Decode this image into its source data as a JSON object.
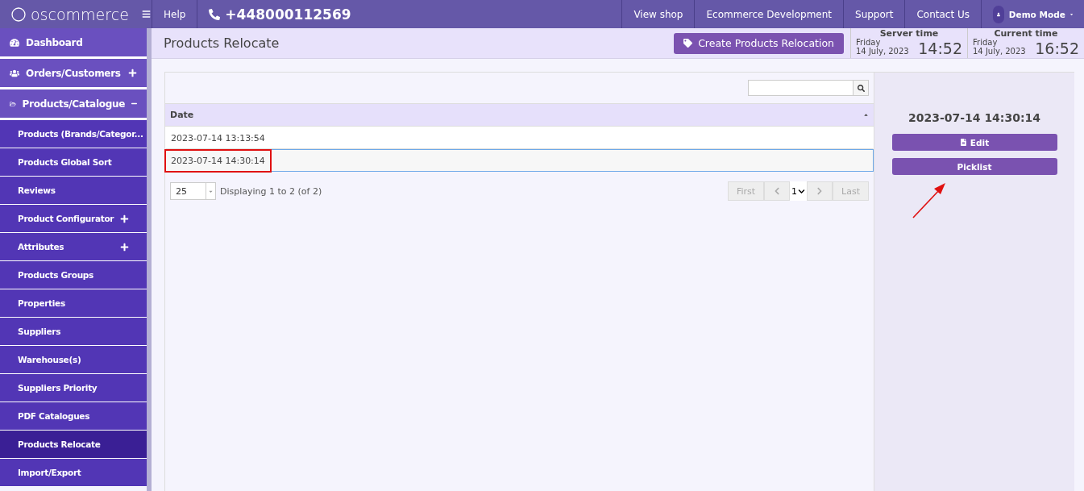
{
  "topbar": {
    "logo": "oscommerce",
    "help": "Help",
    "phone": "+448000112569",
    "links": [
      "View shop",
      "Ecommerce Development",
      "Support",
      "Contact Us"
    ],
    "user": "Demo Mode"
  },
  "sidebar": {
    "items": [
      {
        "label": "Dashboard",
        "selected": false
      },
      {
        "label": "Orders/Customers",
        "selected": false,
        "expanded": false
      },
      {
        "label": "Products/Catalogue",
        "selected": false,
        "expanded": true,
        "children": [
          {
            "label": "Products (Brands/Categor...",
            "selected": false
          },
          {
            "label": "Products Global Sort",
            "selected": false
          },
          {
            "label": "Reviews",
            "selected": false
          },
          {
            "label": "Product Configurator",
            "selected": false,
            "expanded": false
          },
          {
            "label": "Attributes",
            "selected": false,
            "expanded": false
          },
          {
            "label": "Products Groups",
            "selected": false
          },
          {
            "label": "Properties",
            "selected": false
          },
          {
            "label": "Suppliers",
            "selected": false
          },
          {
            "label": "Warehouse(s)",
            "selected": false
          },
          {
            "label": "Suppliers Priority",
            "selected": false
          },
          {
            "label": "PDF Catalogues",
            "selected": false
          },
          {
            "label": "Products Relocate",
            "selected": true
          },
          {
            "label": "Import/Export",
            "selected": false
          }
        ]
      }
    ]
  },
  "header": {
    "title": "Products Relocate",
    "create_button": "Create Products Relocation",
    "clocks": [
      {
        "label": "Server time",
        "day": "Friday",
        "date": "14 July, 2023",
        "time": "14:52"
      },
      {
        "label": "Current time",
        "day": "Friday",
        "date": "14 July, 2023",
        "time": "16:52"
      }
    ]
  },
  "table": {
    "columns": [
      "Date"
    ],
    "rows": [
      {
        "date": "2023-07-14 13:13:54",
        "selected": false
      },
      {
        "date": "2023-07-14 14:30:14",
        "selected": true
      }
    ],
    "page_size": "25",
    "info": "Displaying 1 to 2 (of 2)",
    "pager": {
      "first": "First",
      "page": "1",
      "last": "Last"
    }
  },
  "details": {
    "title": "2023-07-14 14:30:14",
    "buttons": [
      {
        "label": "Edit",
        "kind": "edit"
      },
      {
        "label": "Picklist",
        "kind": "plain"
      }
    ]
  }
}
